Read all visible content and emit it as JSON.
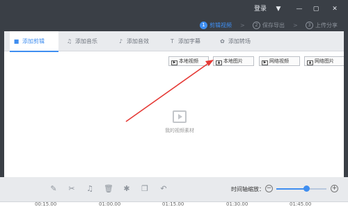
{
  "titlebar": {
    "login_label": "登录",
    "menu_icon": "▼",
    "minimize_icon": "—",
    "maximize_icon": "▢",
    "close_icon": "✕"
  },
  "steps": [
    {
      "num": "1",
      "label": "剪辑视频"
    },
    {
      "num": "2",
      "label": "保存导出"
    },
    {
      "num": "3",
      "label": "上传分享"
    }
  ],
  "step_arrow": ">",
  "tabs": [
    {
      "icon": "■",
      "label": "添加剪辑"
    },
    {
      "icon": "♫",
      "label": "添加音乐"
    },
    {
      "icon": "♪",
      "label": "添加音效"
    },
    {
      "icon": "T",
      "label": "添加字幕"
    },
    {
      "icon": "✿",
      "label": "添加转场"
    }
  ],
  "buttons": [
    {
      "icon": "▶",
      "label": "本地视频"
    },
    {
      "icon": "▲",
      "label": "本地图片"
    },
    {
      "icon": "▶",
      "label": "网络视频"
    },
    {
      "icon": "▲",
      "label": "网络图片"
    }
  ],
  "placeholder_text": "我的视频素材",
  "toolbar": {
    "tools": [
      "✎",
      "✂",
      "♫",
      "🗑",
      "✱",
      "❐",
      "↶"
    ],
    "zoom_label": "时间轴缩放：",
    "zoom_minus": "−",
    "zoom_plus": "+",
    "zoom_level": 0.6
  },
  "ruler": [
    "00:15.00",
    "01:00.00",
    "01:15.00",
    "01:30.00",
    "01:45.00"
  ],
  "colors": {
    "accent": "#3f8ef0",
    "dark": "#3a3f46",
    "arrow": "#e53935"
  }
}
